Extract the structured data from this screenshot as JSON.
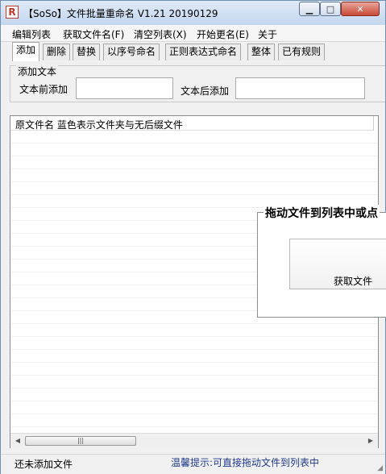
{
  "window": {
    "title": "【SoSo】文件批量重命名   V1.21 20190129",
    "app_icon_glyph": "R"
  },
  "window_controls": {
    "min": "▁",
    "max": "□",
    "close": "✕"
  },
  "menu": [
    "编辑列表",
    "获取文件名(F)",
    "清空列表(X)",
    "开始更名(E)",
    "关于"
  ],
  "tabs": [
    {
      "label": "添加",
      "active": true
    },
    {
      "label": "删除"
    },
    {
      "label": "替换"
    },
    {
      "label": "以序号命名"
    },
    {
      "label": "正则表达式命名"
    },
    {
      "label": "整体"
    },
    {
      "label": "已有规则"
    }
  ],
  "add_panel": {
    "legend": "添加文本",
    "prefix_label": "文本前添加",
    "prefix_value": "",
    "suffix_label": "文本后添加",
    "suffix_value": ""
  },
  "file_list": {
    "header": "原文件名  蓝色表示文件夹与无后缀文件",
    "scroll_thumb": "|||"
  },
  "drop_area": {
    "title": "拖动文件到列表中或点",
    "button_label": "获取文件"
  },
  "status": {
    "left": "还未添加文件",
    "tip": "温馨提示:可直接拖动文件到列表中"
  }
}
